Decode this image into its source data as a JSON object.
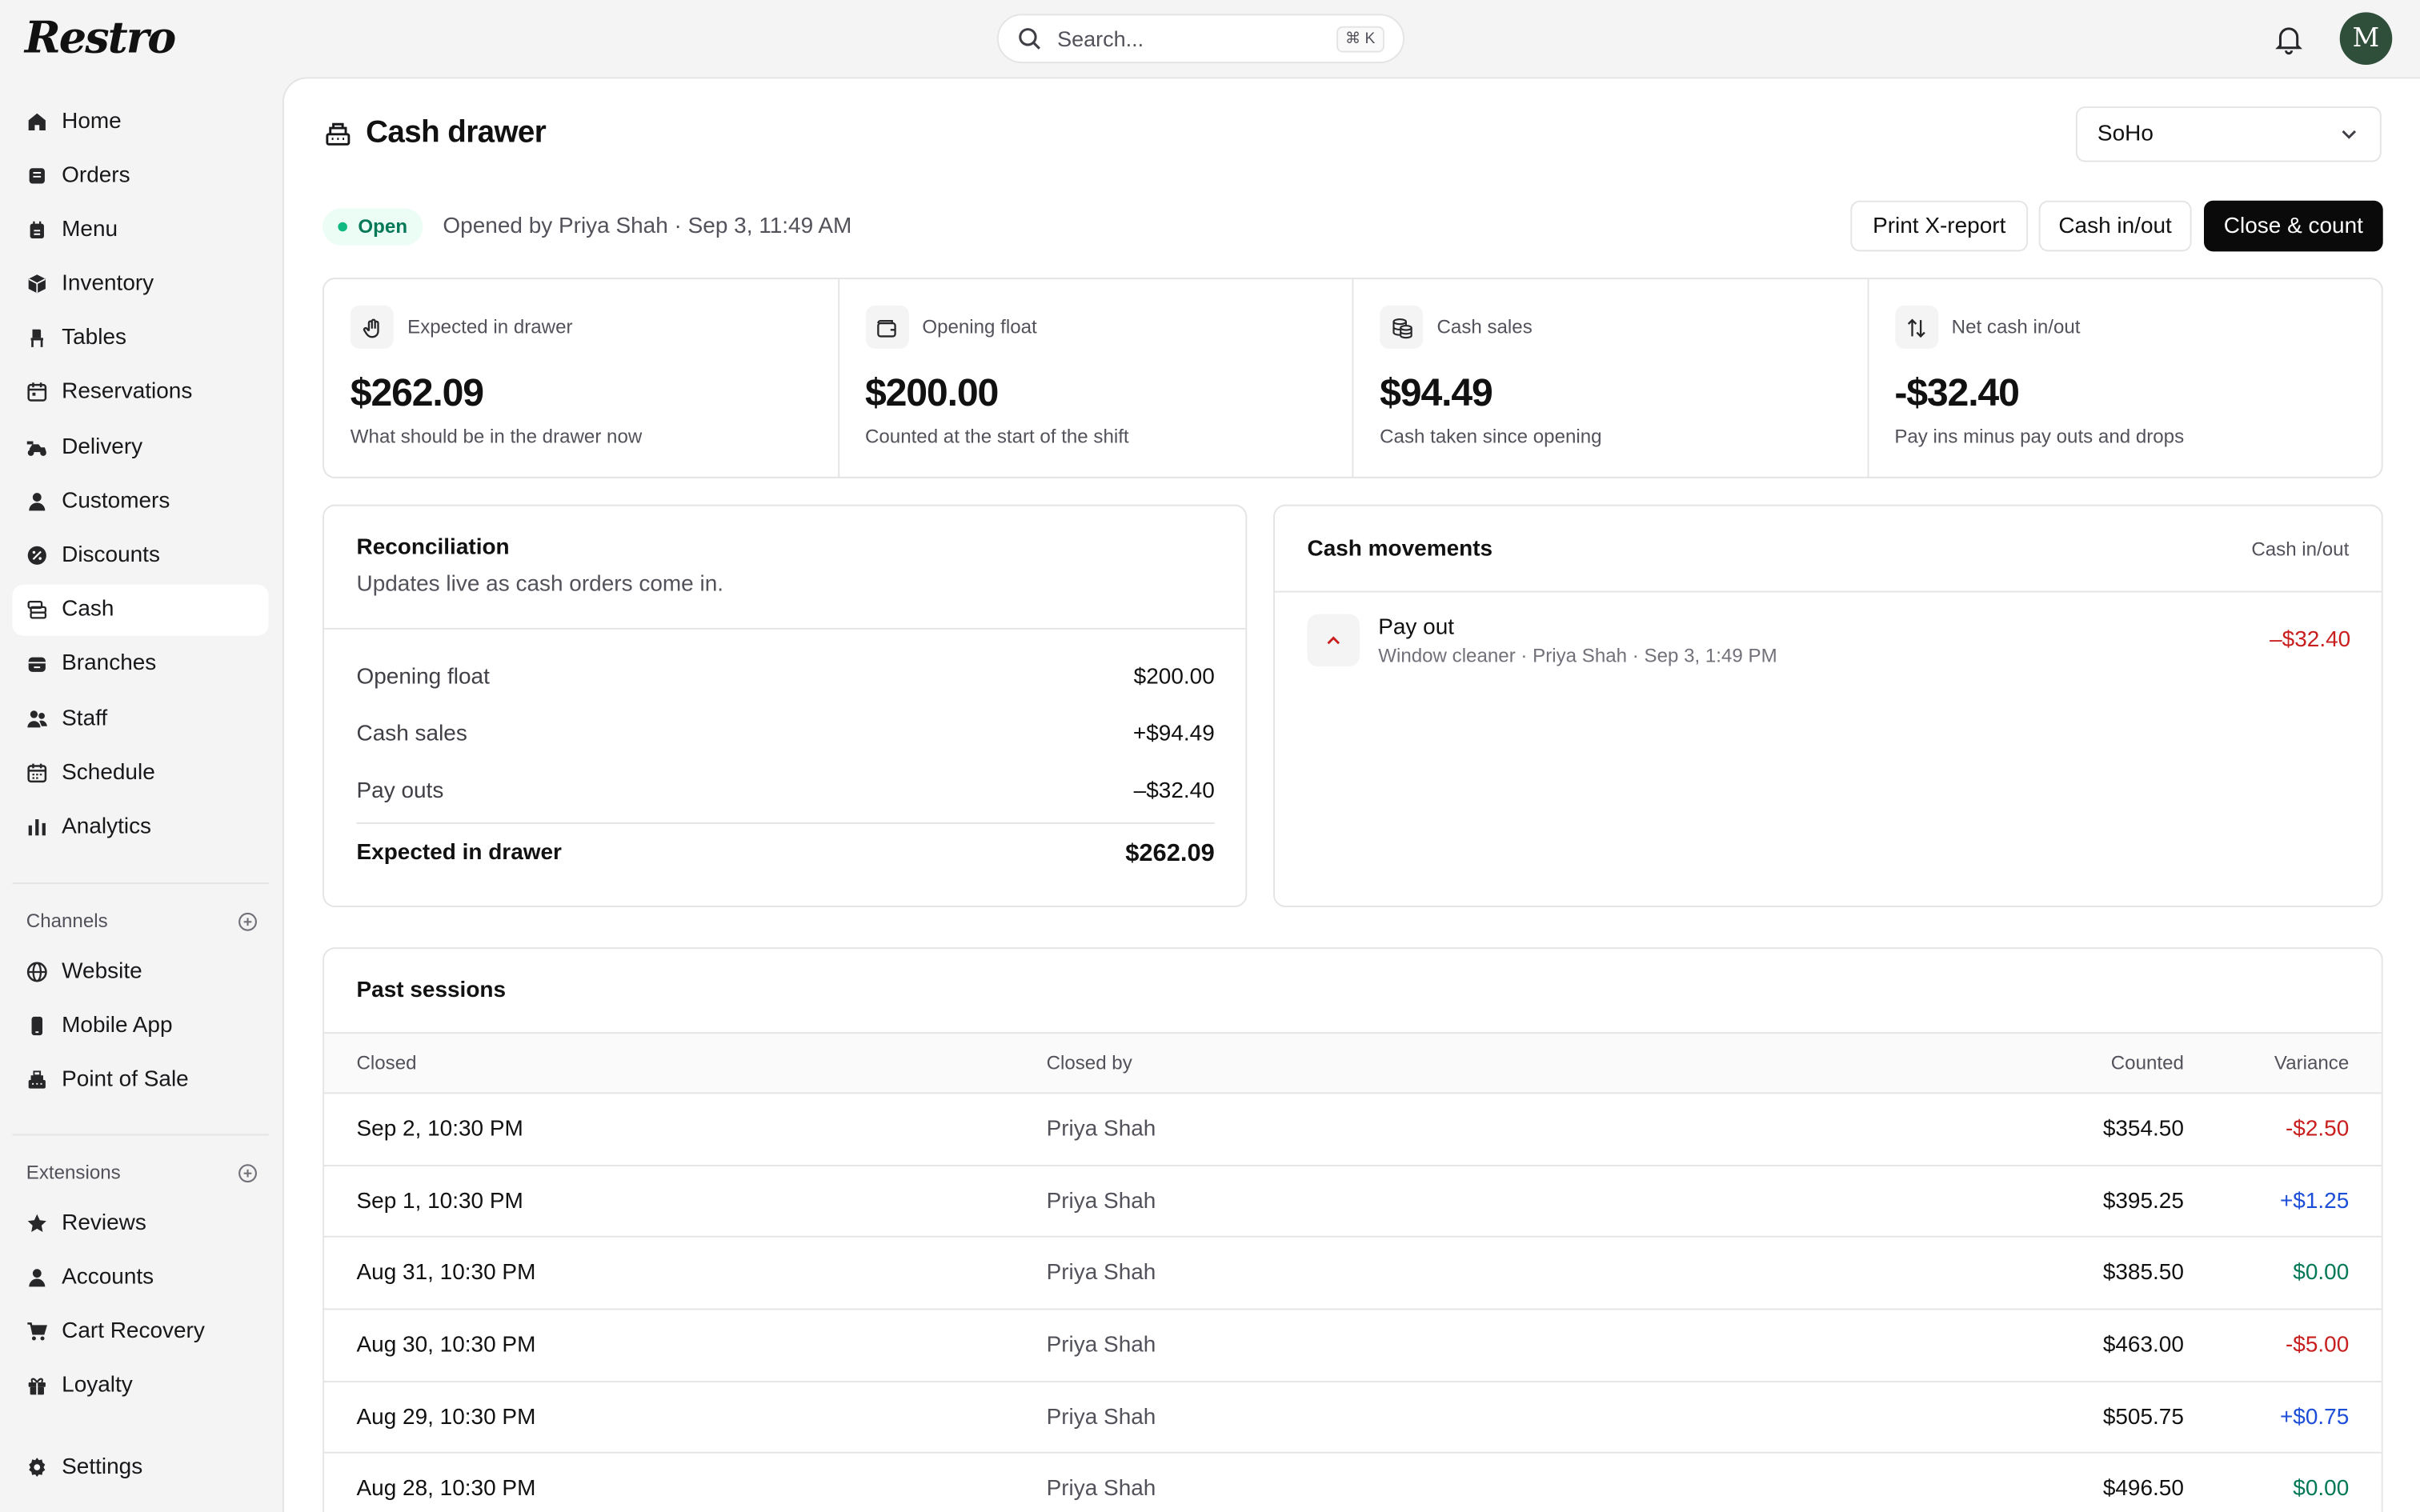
{
  "app": {
    "logo": "Restro"
  },
  "search": {
    "placeholder": "Search...",
    "shortcut": "⌘ K"
  },
  "user": {
    "avatar_initial": "M"
  },
  "sidebar": {
    "items": [
      {
        "label": "Home",
        "icon": "home-icon"
      },
      {
        "label": "Orders",
        "icon": "orders-icon"
      },
      {
        "label": "Menu",
        "icon": "menu-icon"
      },
      {
        "label": "Inventory",
        "icon": "inventory-icon"
      },
      {
        "label": "Tables",
        "icon": "tables-icon"
      },
      {
        "label": "Reservations",
        "icon": "calendar-icon"
      },
      {
        "label": "Delivery",
        "icon": "scooter-icon"
      },
      {
        "label": "Customers",
        "icon": "user-icon"
      },
      {
        "label": "Discounts",
        "icon": "discount-icon"
      },
      {
        "label": "Cash",
        "icon": "cash-icon",
        "active": true
      },
      {
        "label": "Branches",
        "icon": "branches-icon"
      },
      {
        "label": "Staff",
        "icon": "staff-icon"
      },
      {
        "label": "Schedule",
        "icon": "schedule-icon"
      },
      {
        "label": "Analytics",
        "icon": "analytics-icon"
      }
    ],
    "channels_heading": "Channels",
    "channels": [
      {
        "label": "Website",
        "icon": "globe-icon"
      },
      {
        "label": "Mobile App",
        "icon": "phone-icon"
      },
      {
        "label": "Point of Sale",
        "icon": "register-icon"
      }
    ],
    "extensions_heading": "Extensions",
    "extensions": [
      {
        "label": "Reviews",
        "icon": "star-icon"
      },
      {
        "label": "Accounts",
        "icon": "user-icon"
      },
      {
        "label": "Cart Recovery",
        "icon": "cart-icon"
      },
      {
        "label": "Loyalty",
        "icon": "gift-icon"
      }
    ],
    "settings": {
      "label": "Settings",
      "icon": "gear-icon"
    }
  },
  "page": {
    "title": "Cash drawer",
    "branch": "SoHo",
    "status": "Open",
    "opened_by": "Opened by Priya Shah · Sep 3, 11:49 AM",
    "actions": {
      "print": "Print X-report",
      "cash_in_out": "Cash in/out",
      "close": "Close & count"
    }
  },
  "stats": [
    {
      "label": "Expected in drawer",
      "value": "$262.09",
      "sub": "What should be in the drawer now",
      "icon": "hand-coin-icon"
    },
    {
      "label": "Opening float",
      "value": "$200.00",
      "sub": "Counted at the start of the shift",
      "icon": "wallet-icon"
    },
    {
      "label": "Cash sales",
      "value": "$94.49",
      "sub": "Cash taken since opening",
      "icon": "coins-icon"
    },
    {
      "label": "Net cash in/out",
      "value": "-$32.40",
      "sub": "Pay ins minus pay outs and drops",
      "icon": "arrows-up-down-icon"
    }
  ],
  "reconciliation": {
    "title": "Reconciliation",
    "subtitle": "Updates live as cash orders come in.",
    "rows": [
      {
        "label": "Opening float",
        "value": "$200.00"
      },
      {
        "label": "Cash sales",
        "value": "+$94.49"
      },
      {
        "label": "Pay outs",
        "value": "–$32.40"
      }
    ],
    "total": {
      "label": "Expected in drawer",
      "value": "$262.09"
    }
  },
  "movements": {
    "title": "Cash movements",
    "link": "Cash in/out",
    "items": [
      {
        "title": "Pay out",
        "sub": "Window cleaner · Priya Shah · Sep 3, 1:49 PM",
        "amount": "–$32.40"
      }
    ]
  },
  "past_sessions": {
    "title": "Past sessions",
    "columns": [
      "Closed",
      "Closed by",
      "Counted",
      "Variance"
    ],
    "rows": [
      {
        "closed": "Sep 2, 10:30 PM",
        "by": "Priya Shah",
        "counted": "$354.50",
        "variance": "-$2.50",
        "tone": "neg"
      },
      {
        "closed": "Sep 1, 10:30 PM",
        "by": "Priya Shah",
        "counted": "$395.25",
        "variance": "+$1.25",
        "tone": "pos"
      },
      {
        "closed": "Aug 31, 10:30 PM",
        "by": "Priya Shah",
        "counted": "$385.50",
        "variance": "$0.00",
        "tone": "zero"
      },
      {
        "closed": "Aug 30, 10:30 PM",
        "by": "Priya Shah",
        "counted": "$463.00",
        "variance": "-$5.00",
        "tone": "neg"
      },
      {
        "closed": "Aug 29, 10:30 PM",
        "by": "Priya Shah",
        "counted": "$505.75",
        "variance": "+$0.75",
        "tone": "pos"
      },
      {
        "closed": "Aug 28, 10:30 PM",
        "by": "Priya Shah",
        "counted": "$496.50",
        "variance": "$0.00",
        "tone": "zero"
      }
    ]
  },
  "colors": {
    "negative": "#c81e1e",
    "positive": "#1d4ed8",
    "zero": "#047857",
    "open_badge": "#10b981"
  }
}
